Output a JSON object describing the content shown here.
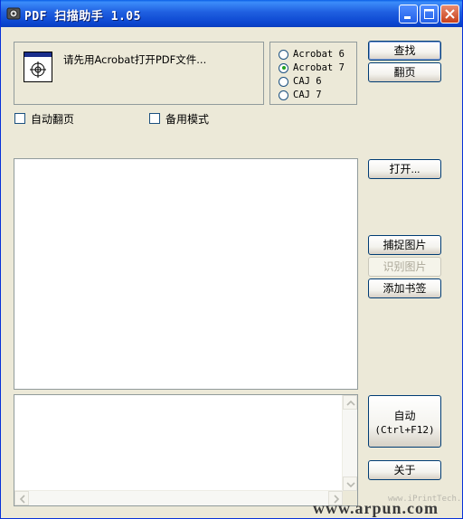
{
  "window": {
    "title": "PDF 扫描助手 1.05",
    "title_buttons": {
      "minimize": "minimize",
      "maximize": "maximize",
      "close": "close"
    }
  },
  "hint": {
    "text": "请先用Acrobat打开PDF文件..."
  },
  "reader_options": {
    "items": [
      {
        "label": "Acrobat 6",
        "checked": false
      },
      {
        "label": "Acrobat 7",
        "checked": true
      },
      {
        "label": "CAJ 6",
        "checked": false
      },
      {
        "label": "CAJ 7",
        "checked": false
      }
    ]
  },
  "buttons": {
    "find": "查找",
    "page_turn": "翻页",
    "open": "打开...",
    "capture_image": "捕捉图片",
    "recognize_image": "识别图片",
    "add_bookmark": "添加书签",
    "auto_line1": "自动",
    "auto_line2": "(Ctrl+F12)",
    "about": "关于"
  },
  "checkboxes": {
    "auto_page_turn": {
      "label": "自动翻页",
      "checked": false
    },
    "backup_mode": {
      "label": "备用模式",
      "checked": false
    }
  },
  "watermark": {
    "main": "www.arpun.com",
    "small": "www.iPrintTech.com"
  },
  "colors": {
    "titlebar": "#0b46d0",
    "window_bg": "#ece9d8",
    "button_border": "#003c74",
    "radio_dot": "#21a121"
  }
}
